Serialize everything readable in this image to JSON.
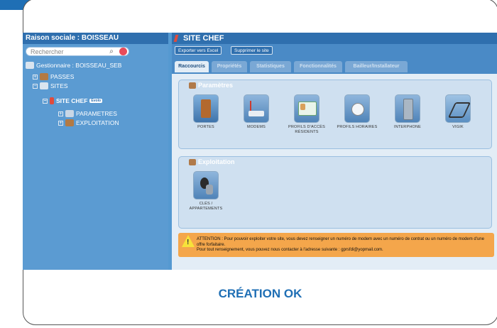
{
  "left_panel": {
    "title": "Raison sociale : BOISSEAU",
    "search_placeholder": "Rechercher",
    "tree": [
      {
        "label": "Gestionnaire : BOISSEAU_SEB",
        "icon": "buildings-icon"
      },
      {
        "label": "PASSES",
        "icon": "keys-icon"
      },
      {
        "label": "SITES",
        "icon": "buildings-icon"
      },
      {
        "label": "SITE CHEF",
        "icon": "site-flag-icon",
        "badge": "Evolo"
      },
      {
        "label": "PARAMETRES",
        "icon": "settings-icon"
      },
      {
        "label": "EXPLOITATION",
        "icon": "keys-icon"
      }
    ]
  },
  "right_panel": {
    "title": "SITE CHEF",
    "toolbar": {
      "export_label": "Exporter vers Excel",
      "delete_label": "Supprimer le site"
    },
    "tabs": [
      {
        "label": "Raccourcis",
        "active": true
      },
      {
        "label": "Propriétés",
        "active": false
      },
      {
        "label": "Statistiques",
        "active": false
      },
      {
        "label": "Fonctionnalités",
        "active": false
      },
      {
        "label": "Bailleur/Installateur",
        "active": false
      }
    ],
    "parametres_section": {
      "title": "Paramètres",
      "tiles": [
        {
          "label": "Portes",
          "icon": "door-icon"
        },
        {
          "label": "Modems",
          "icon": "modem-icon"
        },
        {
          "label": "Profils d'accès Résidents",
          "icon": "id-card-icon"
        },
        {
          "label": "Profils horaires",
          "icon": "clock-icon"
        },
        {
          "label": "Interphone",
          "icon": "intercom-icon"
        },
        {
          "label": "VIGIK",
          "icon": "vigik-icon"
        }
      ]
    },
    "exploitation_section": {
      "title": "Exploitation",
      "tiles": [
        {
          "label": "Clés / Appartements",
          "icon": "keys-icon"
        }
      ]
    },
    "warning": {
      "line1": "ATTENTION : Pour pouvoir exploiter votre site, vous devez renseigner un numéro de modem avec un numéro de contrat ou un numéro de modem d'une offre forfaitaire.",
      "line2": "Pour tout renseignement, vous pouvez nous contacter à l'adresse suivante : gprsfdi@yopmail.com."
    }
  },
  "caption": "CRÉATION OK",
  "colors": {
    "accent": "#1f6fb5",
    "header": "#2f6fae",
    "tree_bg": "#5b9bd2",
    "warning_bg": "#f4a64b"
  }
}
